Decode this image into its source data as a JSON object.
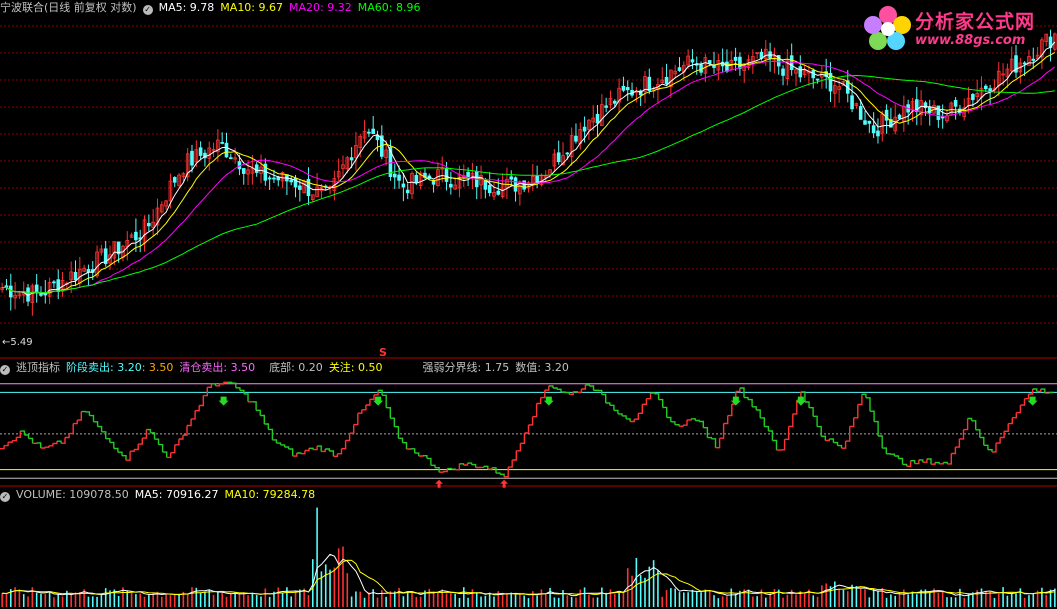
{
  "main_panel": {
    "title": "宁波联合(日线 前复权 对数)",
    "ma5_label": "MA5: 9.78",
    "ma10_label": "MA10: 9.67",
    "ma20_label": "MA20: 9.32",
    "ma60_label": "MA60: 8.96",
    "low_marker": "←5.49"
  },
  "indicator_panel": {
    "title": "逃顶指标",
    "stage_sell_label": "阶段卖出: 3.20",
    "stage_sell_value2": ": 3.50",
    "clear_sell_label": "清仓卖出: 3.50",
    "bottom_label": "底部: 0.20",
    "watch_label": "关注: 0.50",
    "strength_line_label": "强弱分界线: 1.75",
    "value_label": "数值: 3.20",
    "signal_text": "S"
  },
  "volume_panel": {
    "volume_label": "VOLUME: 109078.50",
    "ma5_label": "MA5: 70916.27",
    "ma10_label": "MA10: 79284.78"
  },
  "watermark": {
    "title": "分析家公式网",
    "url": "www.88gs.com"
  },
  "colors": {
    "up": "#ff3232",
    "down": "#54fcfc",
    "ma5": "#ffffff",
    "ma10": "#ffff00",
    "ma20": "#ff00ff",
    "ma60": "#00ff00",
    "ind_up": "#ff3232",
    "ind_down": "#22cc22",
    "grid": "#8b0000"
  },
  "chart_data": [
    {
      "type": "line",
      "title": "宁波联合(日线 前复权 对数)",
      "series": [
        {
          "name": "MA5",
          "last": 9.78
        },
        {
          "name": "MA10",
          "last": 9.67
        },
        {
          "name": "MA20",
          "last": 9.32
        },
        {
          "name": "MA60",
          "last": 8.96
        }
      ],
      "annotations": [
        "←5.49"
      ],
      "price_path": [
        5.6,
        5.5,
        5.8,
        6.1,
        6.5,
        7.6,
        8.0,
        7.4,
        7.3,
        7.0,
        8.4,
        7.2,
        7.4,
        7.3,
        7.2,
        7.5,
        8.4,
        9.0,
        9.4,
        9.8,
        9.6,
        9.9,
        9.5,
        9.3,
        8.3,
        8.8,
        8.6,
        9.2,
        9.8,
        10.5
      ]
    },
    {
      "type": "line",
      "title": "逃顶指标",
      "levels": {
        "stage_sell": 3.2,
        "clear_sell": 3.5,
        "bottom": 0.2,
        "watch": 0.5,
        "strength_line": 1.75
      },
      "value_last": 3.2,
      "values": [
        1.3,
        1.8,
        1.2,
        1.5,
        2.6,
        1.6,
        0.9,
        1.9,
        0.9,
        2.2,
        3.5,
        3.5,
        2.8,
        1.5,
        1.0,
        1.3,
        1.0,
        2.4,
        3.3,
        1.4,
        1.0,
        0.4,
        0.7,
        0.6,
        0.3,
        2.0,
        3.5,
        3.1,
        3.5,
        2.7,
        2.2,
        3.2,
        2.0,
        2.3,
        1.3,
        3.4,
        2.5,
        1.0,
        3.3,
        1.7,
        1.2,
        3.3,
        1.1,
        0.7,
        0.8,
        0.7,
        2.4,
        1.0,
        2.3,
        3.3,
        3.2
      ]
    },
    {
      "type": "bar",
      "title": "VOLUME",
      "series": [
        {
          "name": "VOLUME",
          "last": 109078.5
        },
        {
          "name": "MA5",
          "last": 70916.27
        },
        {
          "name": "MA10",
          "last": 79284.78
        }
      ]
    }
  ]
}
